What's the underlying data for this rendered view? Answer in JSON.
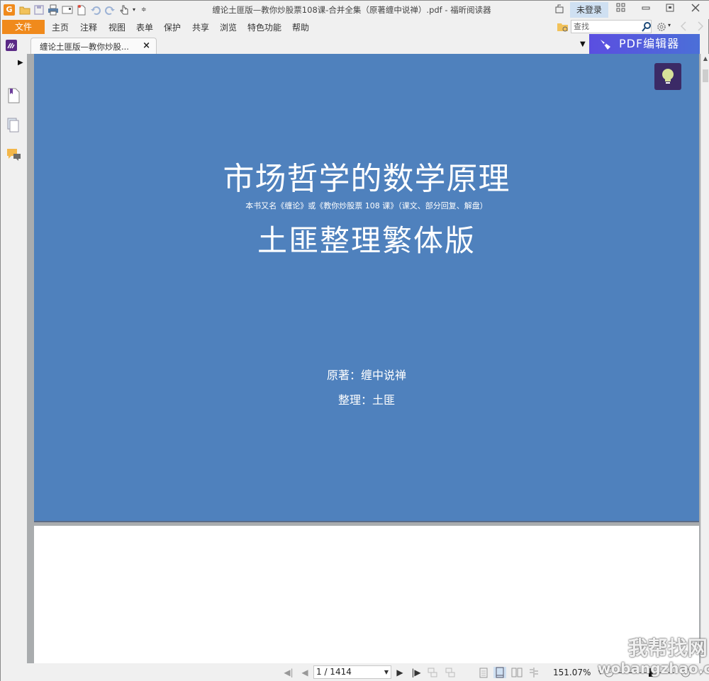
{
  "window": {
    "title": "缠论土匪版—教你炒股票108课-合并全集（原著缠中说禅）.pdf - 福昕阅读器",
    "login_label": "未登录"
  },
  "quick_access": {
    "icons": [
      "app-logo",
      "open-folder",
      "save",
      "print",
      "scan",
      "new-document",
      "undo",
      "redo",
      "hand-tool",
      "customize"
    ]
  },
  "menu": {
    "file": "文件",
    "items": [
      "主页",
      "注释",
      "视图",
      "表单",
      "保护",
      "共享",
      "浏览",
      "特色功能",
      "帮助"
    ]
  },
  "search": {
    "placeholder": "查找"
  },
  "tab": {
    "label": "缠论土匪版—教你炒股...",
    "close": "×"
  },
  "pdf_editor": {
    "label": "PDF编辑器"
  },
  "document": {
    "title_main": "市场哲学的数学原理",
    "subtitle": "本书又名《缠论》或《教你炒股票 108 课》（课文、部分回复、解盘）",
    "title_secondary": "土匪整理繁体版",
    "author": "原著：缠中说禅",
    "editor": "整理：土匪",
    "page_color": "#4f81bd"
  },
  "statusbar": {
    "page_display": "1 / 1414",
    "current_page": 1,
    "total_pages": 1414,
    "zoom": "151.07%"
  },
  "watermark": {
    "line1": "我帮找网",
    "line2": "wobangzhao.com"
  }
}
